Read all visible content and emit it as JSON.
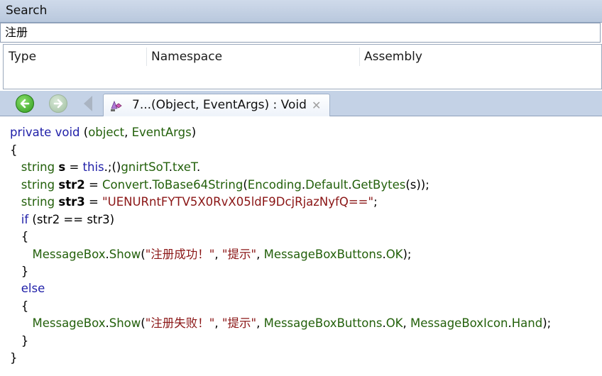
{
  "search_panel": {
    "title": "Search",
    "query": "注册",
    "columns": [
      "Type",
      "Namespace",
      "Assembly"
    ]
  },
  "tab": {
    "label": "7...(Object, EventArgs) : Void",
    "close_glyph": "✕"
  },
  "code": {
    "l1": {
      "kw1": "private",
      "sp1": " ",
      "kw2": "void",
      "sp2": " (",
      "ty1": "object",
      "p1": ", ",
      "ty2": "EventArgs",
      "p2": ")"
    },
    "l2": {
      "p1": "{"
    },
    "l3": {
      "ind": "   ",
      "kw1": "string",
      "sp": " ",
      "b": "s",
      "p1": " = ",
      "kw2": "this",
      "p2": ".;()",
      "ty1": "gnirtSoT",
      "p3": ".",
      "ty2": "txeT",
      "p4": "."
    },
    "l4": {
      "ind": "   ",
      "kw1": "string",
      "sp": " ",
      "b": "str2",
      "p1": " = ",
      "ty1": "Convert",
      "p2": ".",
      "ty2": "ToBase64String",
      "p3": "(",
      "ty3": "Encoding",
      "p4": ".",
      "ty4": "Default",
      "p5": ".",
      "ty5": "GetBytes",
      "p6": "(s));"
    },
    "l5": {
      "ind": "   ",
      "kw1": "string",
      "sp": " ",
      "b": "str3",
      "p1": " = ",
      "s1": "\"UENURntFYTV5X0RvX05ldF9DcjRjazNyfQ==\"",
      "p2": ";"
    },
    "l6": {
      "ind": "   ",
      "kw1": "if",
      "p1": " (str2 == str3)"
    },
    "l7": {
      "ind": "   ",
      "p1": "{"
    },
    "l8": {
      "ind": "      ",
      "ty1": "MessageBox",
      "p1": ".",
      "ty2": "Show",
      "p2": "(",
      "s1": "\"注册成功！\"",
      "p3": ", ",
      "s2": "\"提示\"",
      "p4": ", ",
      "ty3": "MessageBoxButtons",
      "p5": ".",
      "ty4": "OK",
      "p6": ");"
    },
    "l9": {
      "ind": "   ",
      "p1": "}"
    },
    "l10": {
      "ind": "   ",
      "kw1": "else"
    },
    "l11": {
      "ind": "   ",
      "p1": "{"
    },
    "l12": {
      "ind": "      ",
      "ty1": "MessageBox",
      "p1": ".",
      "ty2": "Show",
      "p2": "(",
      "s1": "\"注册失败！\"",
      "p3": ", ",
      "s2": "\"提示\"",
      "p4": ", ",
      "ty3": "MessageBoxButtons",
      "p5": ".",
      "ty4": "OK",
      "p6": ", ",
      "ty5": "MessageBoxIcon",
      "p7": ".",
      "ty6": "Hand",
      "p8": ");"
    },
    "l13": {
      "ind": "   ",
      "p1": "}"
    },
    "l14": {
      "p1": "}"
    }
  },
  "icons": {
    "back": "arrow-left-icon",
    "forward": "arrow-right-icon",
    "method": "method-icon"
  },
  "colors": {
    "keyword": "#1f1fa8",
    "type": "#23600b",
    "string": "#8a1515"
  }
}
